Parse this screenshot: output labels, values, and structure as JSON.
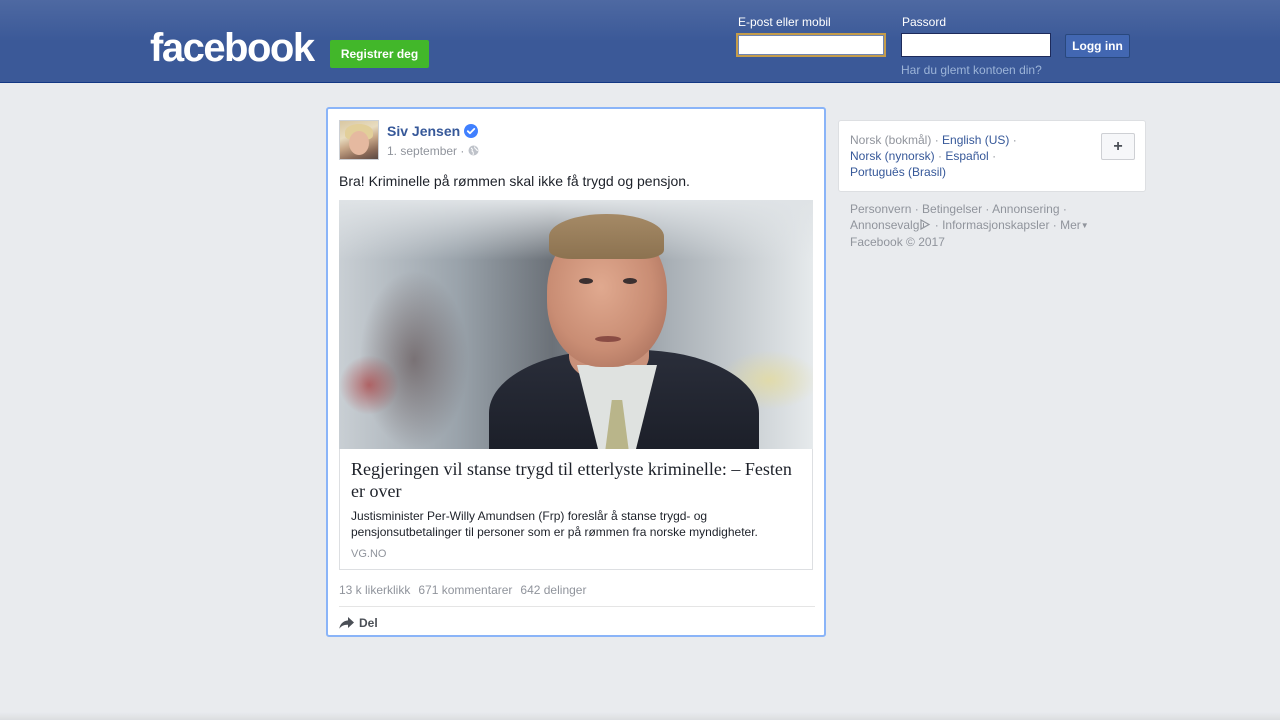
{
  "header": {
    "logo": "facebook",
    "register_label": "Registrer deg",
    "email_label": "E-post eller mobil",
    "email_value": "",
    "password_label": "Passord",
    "password_value": "",
    "login_label": "Logg inn",
    "forgot_label": "Har du glemt kontoen din?"
  },
  "post": {
    "author": "Siv Jensen",
    "date": "1. september ·",
    "text": "Bra! Kriminelle på rømmen skal ikke få trygd og pensjon.",
    "link": {
      "title": "Regjeringen vil stanse trygd til etterlyste kriminelle: – Festen er over",
      "description": "Justisminister Per-Willy Amundsen (Frp) foreslår å stanse trygd- og pensjonsutbetalinger til personer som er på rømmen fra norske myndigheter.",
      "source": "VG.NO"
    },
    "stats": {
      "likes": "13 k likerklikk",
      "comments": "671 kommentarer",
      "shares": "642 delinger"
    },
    "share_label": "Del"
  },
  "sidebar": {
    "languages": {
      "current": "Norsk (bokmål)",
      "english": "English (US)",
      "nynorsk": "Norsk (nynorsk)",
      "spanish": "Español",
      "portuguese": "Português (Brasil)",
      "add_label": "+"
    },
    "footer": {
      "privacy": "Personvern",
      "terms": "Betingelser",
      "ads": "Annonsering",
      "adchoices": "Annonsevalg",
      "cookies": "Informasjonskapsler",
      "more": "Mer",
      "copyright": "Facebook © 2017"
    }
  },
  "colors": {
    "brand_blue": "#3b5998",
    "register_green": "#42b72a",
    "link_blue": "#365899"
  }
}
